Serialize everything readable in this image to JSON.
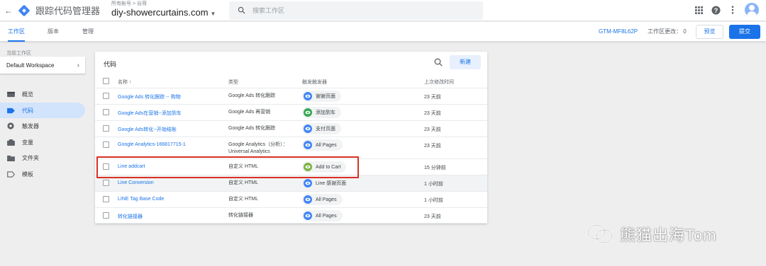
{
  "header": {
    "app_title": "跟踪代码管理器",
    "breadcrumb": "所有帐号 > 谷哥",
    "container": "diy-showercurtains.com",
    "search_placeholder": "搜索工作区"
  },
  "tabs": [
    {
      "label": "工作区",
      "active": true
    },
    {
      "label": "版本",
      "active": false
    },
    {
      "label": "管理",
      "active": false
    }
  ],
  "workspace_info": {
    "container_id": "GTM-MF8L62P",
    "changes_label": "工作区更改：",
    "changes_count": "0",
    "preview_label": "预览",
    "submit_label": "提交"
  },
  "sidebar": {
    "current_workspace_label": "当前工作区",
    "workspace_name": "Default Workspace",
    "items": [
      {
        "label": "概览",
        "icon": "overview-icon"
      },
      {
        "label": "代码",
        "icon": "tag-icon",
        "active": true
      },
      {
        "label": "触发器",
        "icon": "trigger-icon"
      },
      {
        "label": "变量",
        "icon": "variable-icon"
      },
      {
        "label": "文件夹",
        "icon": "folder-icon"
      },
      {
        "label": "模板",
        "icon": "template-icon"
      }
    ]
  },
  "tags_panel": {
    "title": "代码",
    "new_label": "新建",
    "columns": {
      "name": "名称 ↑",
      "type": "类型",
      "trigger": "触发触发器",
      "last_edited": "上次修改时间"
    },
    "rows": [
      {
        "name": "Google Ads 转化跟踪 -- 购物",
        "type": "Google Ads 转化跟踪",
        "type2": "",
        "trigger": "谢谢页面",
        "trigger_color": "#4285f4",
        "time": "23 天前"
      },
      {
        "name": "Google Ads在营销--添加到车",
        "type": "Google Ads 再营销",
        "type2": "",
        "trigger": "添加到车",
        "trigger_color": "#34a853",
        "time": "23 天前"
      },
      {
        "name": "Google Ads转化--开始结账",
        "type": "Google Ads 转化跟踪",
        "type2": "",
        "trigger": "支付页面",
        "trigger_color": "#4285f4",
        "time": "23 天前"
      },
      {
        "name": "Google Analytics-166817715-1",
        "type": "Google Analytics（分析）：",
        "type2": "Universal Analytics",
        "trigger": "All Pages",
        "trigger_color": "#4285f4",
        "time": "23 天前"
      },
      {
        "name": "Line addcart",
        "type": "自定义 HTML",
        "type2": "",
        "trigger": "Add to Cart",
        "trigger_color": "#7cb342",
        "time": "15 分钟前"
      },
      {
        "name": "Line Conversion",
        "type": "自定义 HTML",
        "type2": "",
        "trigger": "Line 感谢页面",
        "trigger_color": "#4285f4",
        "time": "1 小时前"
      },
      {
        "name": "LINE Tag Base Code",
        "type": "自定义 HTML",
        "type2": "",
        "trigger": "All Pages",
        "trigger_color": "#4285f4",
        "time": "1 小时前"
      },
      {
        "name": "转化链接器",
        "type": "转化链接器",
        "type2": "",
        "trigger": "All Pages",
        "trigger_color": "#4285f4",
        "time": "23 天前"
      }
    ]
  },
  "watermark": {
    "text": "熊猫出海Tom"
  },
  "colors": {
    "accent": "#1a73e8",
    "highlight_box": "#d93025"
  }
}
